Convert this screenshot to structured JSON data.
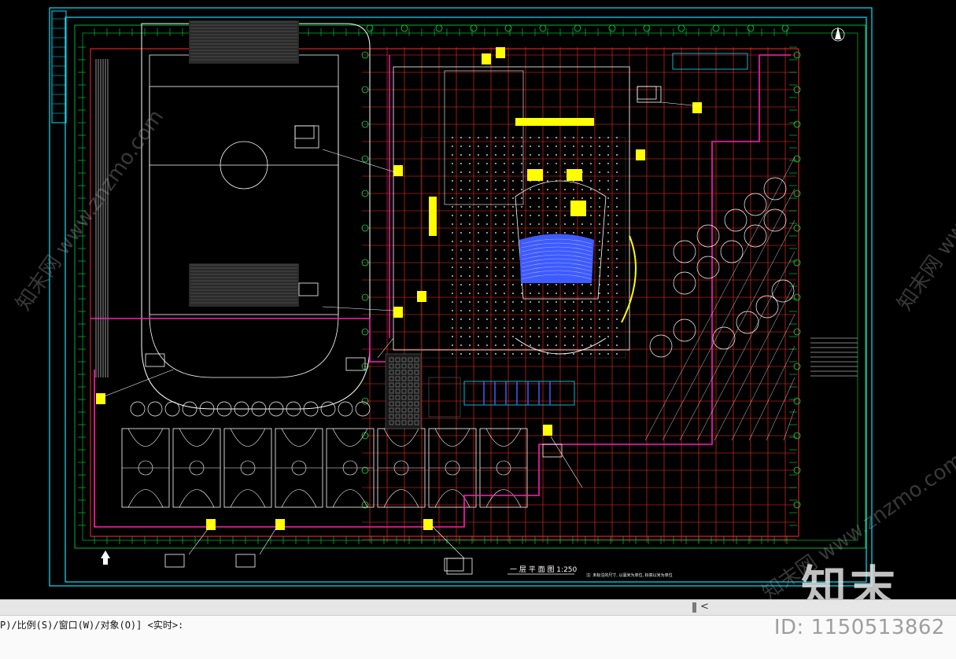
{
  "drawing": {
    "sheet_title": "一 层 平 面 图  1:250",
    "sheet_note": "注: 未标注的尺寸, 以毫米为单位, 标高以米为单位",
    "colors": {
      "background": "#000000",
      "border": "#00e5ff",
      "grid_red": "#ff2d2d",
      "magenta": "#ff1fb4",
      "green": "#00e040",
      "white": "#ffffff",
      "yellow": "#ffff00",
      "blue": "#3e5bff"
    }
  },
  "scrollbar": {
    "left_arrow": "<"
  },
  "command_line": {
    "text": "P)/比例(S)/窗口(W)/对象(O)] <实时>:"
  },
  "watermark": {
    "logo": "知末",
    "id": "ID: 1150513862",
    "site": "知末网 www.znzmo.com"
  }
}
